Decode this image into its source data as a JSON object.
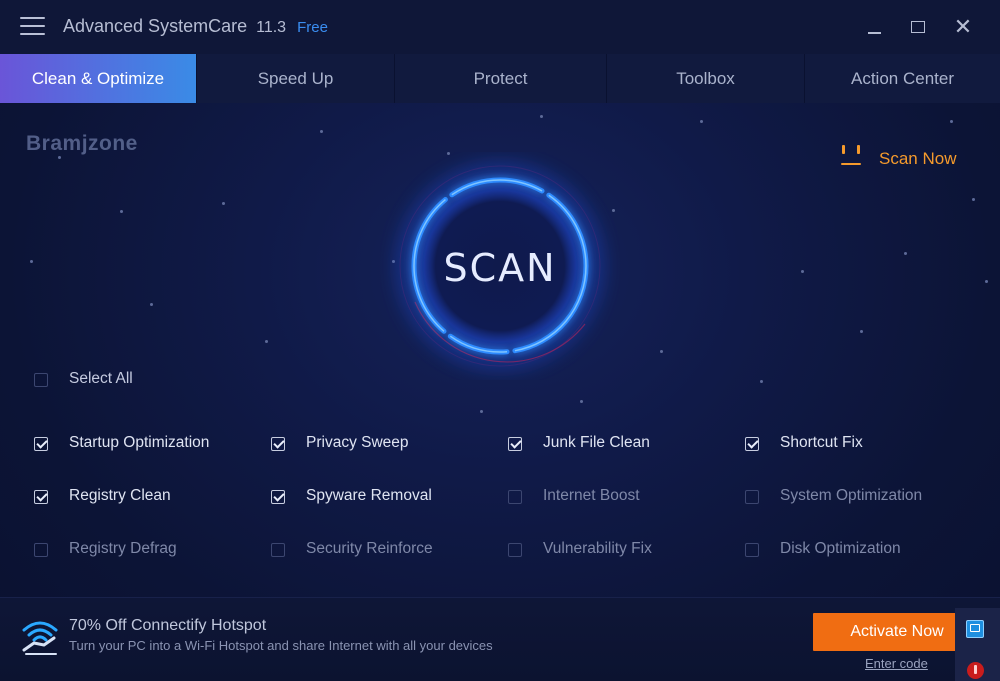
{
  "app": {
    "title": "Advanced SystemCare",
    "version": "11.3",
    "edition": "Free"
  },
  "window_controls": {
    "close_glyph": "✕"
  },
  "tabs": [
    {
      "label": "Clean & Optimize",
      "active": true
    },
    {
      "label": "Speed Up",
      "active": false
    },
    {
      "label": "Protect",
      "active": false
    },
    {
      "label": "Toolbox",
      "active": false
    },
    {
      "label": "Action Center",
      "active": false
    }
  ],
  "watermark": "Bramjzone",
  "scan_now": {
    "label": "Scan Now",
    "icon": "face-icon",
    "color": "#f59a2c"
  },
  "scan": {
    "label": "SCAN"
  },
  "select_all": {
    "label": "Select All",
    "checked": false
  },
  "options": [
    {
      "label": "Startup Optimization",
      "checked": true
    },
    {
      "label": "Privacy Sweep",
      "checked": true
    },
    {
      "label": "Junk File Clean",
      "checked": true
    },
    {
      "label": "Shortcut Fix",
      "checked": true
    },
    {
      "label": "Registry Clean",
      "checked": true
    },
    {
      "label": "Spyware Removal",
      "checked": true
    },
    {
      "label": "Internet Boost",
      "checked": false
    },
    {
      "label": "System Optimization",
      "checked": false
    },
    {
      "label": "Registry Defrag",
      "checked": false
    },
    {
      "label": "Security Reinforce",
      "checked": false
    },
    {
      "label": "Vulnerability Fix",
      "checked": false
    },
    {
      "label": "Disk Optimization",
      "checked": false
    }
  ],
  "promo": {
    "title": "70% Off Connectify Hotspot",
    "subtitle": "Turn your PC into a Wi-Fi Hotspot and share Internet with all your devices",
    "icon": "wifi-hotspot-icon"
  },
  "activate": {
    "label": "Activate Now",
    "color": "#f06d12"
  },
  "enter_code": {
    "label": "Enter code"
  },
  "colors": {
    "accent_blue": "#3a8be6",
    "accent_purple": "#6a55d8",
    "ring_glow": "#1f7dff",
    "background": "#0d1431"
  }
}
